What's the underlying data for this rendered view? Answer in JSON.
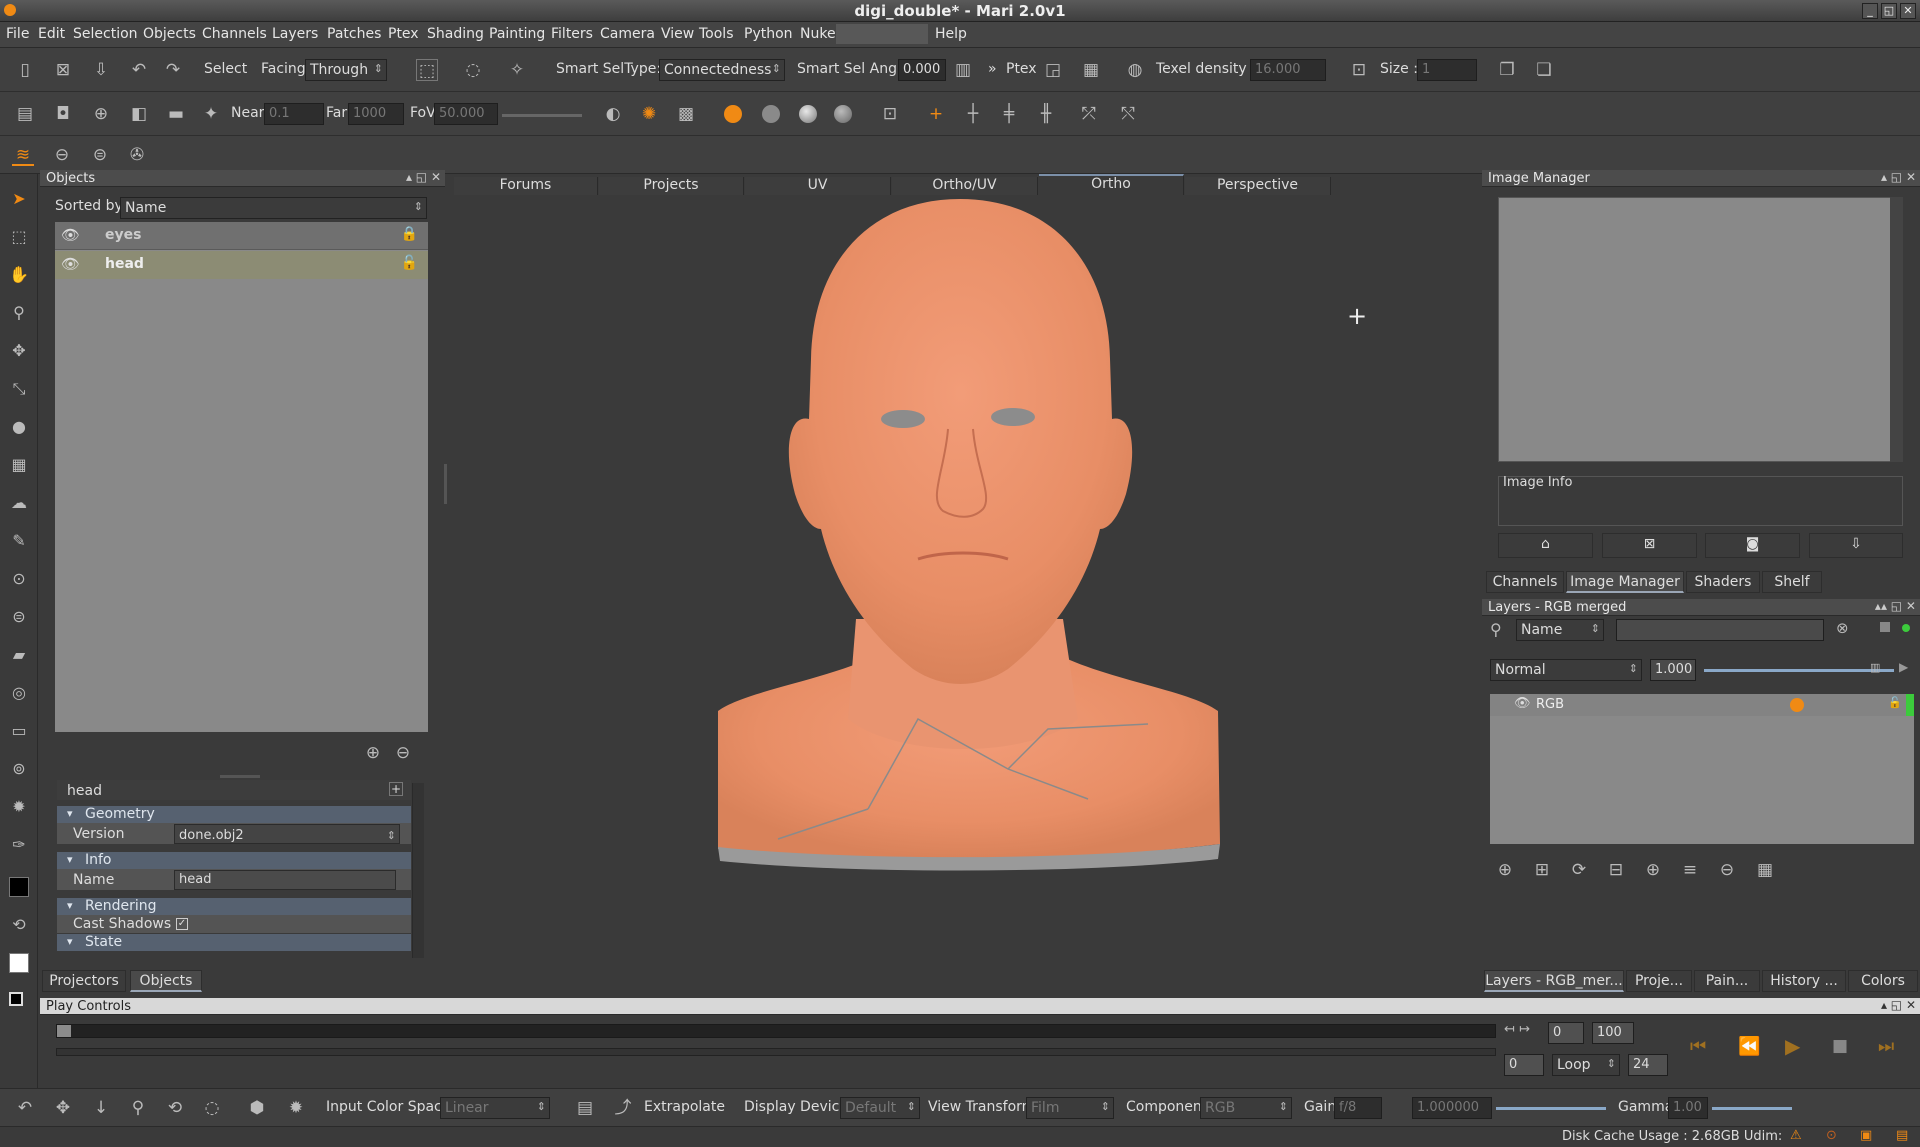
{
  "window": {
    "title": "digi_double* - Mari 2.0v1"
  },
  "menu": [
    "File",
    "Edit",
    "Selection",
    "Objects",
    "Channels",
    "Layers",
    "Patches",
    "Ptex",
    "Shading",
    "Painting",
    "Filters",
    "Camera",
    "View",
    "Tools",
    "Python",
    "Nuke",
    "Help"
  ],
  "toolbar1": {
    "select_label": "Select",
    "facing_label": "Facing",
    "facing_value": "Through",
    "smart_seltype_label": "Smart SelType:",
    "smart_seltype_value": "Connectedness",
    "smart_sel_angle_label": "Smart Sel Angle",
    "smart_sel_angle_value": "0.000",
    "ptex_label": "Ptex",
    "texel_density_label": "Texel density :",
    "texel_density_value": "16.000",
    "size_label": "Size :",
    "size_value": "1"
  },
  "toolbar2": {
    "near_label": "Near",
    "near_value": "0.1",
    "far_label": "Far",
    "far_value": "1000",
    "fov_label": "FoV",
    "fov_value": "50.000"
  },
  "objects_panel": {
    "title": "Objects",
    "sorted_by_label": "Sorted by",
    "sorted_by_value": "Name",
    "items": [
      {
        "name": "eyes",
        "selected": false
      },
      {
        "name": "head",
        "selected": true
      }
    ]
  },
  "properties": {
    "object_name": "head",
    "sections": {
      "geometry": "Geometry",
      "info": "Info",
      "rendering": "Rendering",
      "state": "State"
    },
    "version_label": "Version",
    "version_value": "done.obj2",
    "name_label": "Name",
    "name_value": "head",
    "cast_shadows_label": "Cast Shadows"
  },
  "left_tabs": [
    "Projectors",
    "Objects"
  ],
  "viewport_tabs": [
    "Forums",
    "Projects",
    "UV",
    "Ortho/UV",
    "Ortho",
    "Perspective"
  ],
  "viewport_active_tab": "Ortho",
  "image_manager": {
    "title": "Image Manager",
    "image_info_label": "Image Info"
  },
  "right_tabs": [
    "Channels",
    "Image Manager",
    "Shaders",
    "Shelf"
  ],
  "layers_panel": {
    "title": "Layers - RGB merged",
    "filter_label": "Name",
    "blend_mode": "Normal",
    "opacity": "1.000",
    "layers": [
      {
        "name": "RGB"
      }
    ]
  },
  "right_bottom_tabs": [
    "Layers - RGB_mer...",
    "Proje...",
    "Pain...",
    "History ...",
    "Colors"
  ],
  "play_controls": {
    "title": "Play Controls",
    "start_frame": "0",
    "end_frame": "100",
    "current_frame": "0",
    "loop_mode": "Loop",
    "fps": "24"
  },
  "bottom_toolbar": {
    "input_color_space_label": "Input Color Space",
    "input_color_space_value": "Linear",
    "extrapolate_label": "Extrapolate",
    "display_device_label": "Display Device",
    "display_device_value": "Default",
    "view_transform_label": "View Transform",
    "view_transform_value": "Film",
    "component_label": "Component",
    "component_value": "RGB",
    "gain_label": "Gain",
    "gain_value": "f/8",
    "gain_number": "1.000000",
    "gamma_label": "Gamma",
    "gamma_value": "1.00"
  },
  "status": {
    "disk_cache": "Disk Cache Usage : 2.68GB Udim:"
  },
  "colors": {
    "accent": "#f08a14",
    "panel_bg": "#3c3c3c",
    "selected_row": "#8c8c74",
    "section_header": "#566170",
    "skin": "#e9926c"
  }
}
